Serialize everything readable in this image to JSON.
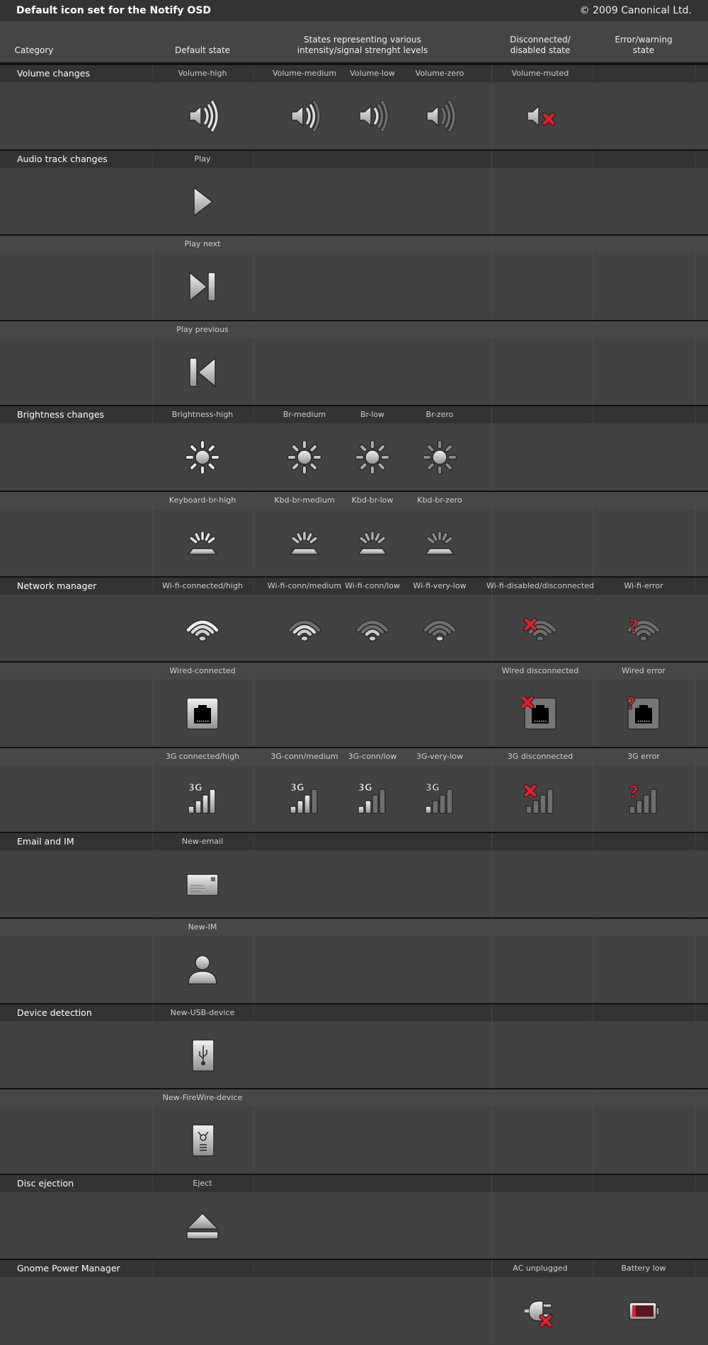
{
  "header": {
    "title": "Default icon set for the Notify OSD",
    "copyright": "© 2009 Canonical Ltd."
  },
  "columns": {
    "category": "Category",
    "default": "Default state",
    "intensity": "States representing various\nintensity/signal strenght levels",
    "disconnected": "Disconnected/\ndisabled state",
    "error": "Error/warning\nstate"
  },
  "rows": [
    {
      "category": "Volume changes",
      "cells": [
        {
          "label": "Volume-high",
          "icon": "volume",
          "level": 3
        },
        {
          "label": "Volume-medium",
          "icon": "volume",
          "level": 2
        },
        {
          "label": "Volume-low",
          "icon": "volume",
          "level": 1
        },
        {
          "label": "Volume-zero",
          "icon": "volume",
          "level": 0
        },
        {
          "label": "Volume-muted",
          "icon": "volume",
          "level": -1,
          "overlay": "x"
        },
        null
      ]
    },
    {
      "category": "Audio track changes",
      "cells": [
        {
          "label": "Play",
          "icon": "play"
        },
        null,
        null,
        null,
        null,
        null
      ]
    },
    {
      "category": "",
      "cells": [
        {
          "label": "Play next",
          "icon": "next"
        },
        null,
        null,
        null,
        null,
        null
      ]
    },
    {
      "category": "",
      "cells": [
        {
          "label": "Play previous",
          "icon": "prev"
        },
        null,
        null,
        null,
        null,
        null
      ]
    },
    {
      "category": "Brightness changes",
      "cells": [
        {
          "label": "Brightness-high",
          "icon": "brightness",
          "level": 3
        },
        {
          "label": "Br-medium",
          "icon": "brightness",
          "level": 2
        },
        {
          "label": "Br-low",
          "icon": "brightness",
          "level": 1
        },
        {
          "label": "Br-zero",
          "icon": "brightness",
          "level": 0
        },
        null,
        null
      ]
    },
    {
      "category": "",
      "cells": [
        {
          "label": "Keyboard-br-high",
          "icon": "kbd",
          "level": 3
        },
        {
          "label": "Kbd-br-medium",
          "icon": "kbd",
          "level": 2
        },
        {
          "label": "Kbd-br-low",
          "icon": "kbd",
          "level": 1
        },
        {
          "label": "Kbd-br-zero",
          "icon": "kbd",
          "level": 0
        },
        null,
        null
      ]
    },
    {
      "category": "Network manager",
      "cells": [
        {
          "label": "Wi-fi-connected/high",
          "icon": "wifi",
          "level": 3
        },
        {
          "label": "Wi-fi-conn/medium",
          "icon": "wifi",
          "level": 2
        },
        {
          "label": "Wi-fi-conn/low",
          "icon": "wifi",
          "level": 1
        },
        {
          "label": "Wi-fi-very-low",
          "icon": "wifi",
          "level": 0
        },
        {
          "label": "Wi-fi-disabled/disconnected",
          "icon": "wifi",
          "level": -1,
          "overlay": "x"
        },
        {
          "label": "Wi-fi-error",
          "icon": "wifi",
          "level": -1,
          "overlay": "?"
        }
      ]
    },
    {
      "category": "",
      "cells": [
        {
          "label": "Wired-connected",
          "icon": "wired",
          "level": 1
        },
        null,
        null,
        null,
        {
          "label": "Wired disconnected",
          "icon": "wired",
          "level": 0,
          "overlay": "x"
        },
        {
          "label": "Wired error",
          "icon": "wired",
          "level": 0,
          "overlay": "?"
        }
      ]
    },
    {
      "category": "",
      "cells": [
        {
          "label": "3G connected/high",
          "icon": "3g",
          "level": 4
        },
        {
          "label": "3G-conn/medium",
          "icon": "3g",
          "level": 3
        },
        {
          "label": "3G-conn/low",
          "icon": "3g",
          "level": 2
        },
        {
          "label": "3G-very-low",
          "icon": "3g",
          "level": 1
        },
        {
          "label": "3G disconnected",
          "icon": "3g",
          "level": -1,
          "overlay": "x"
        },
        {
          "label": "3G error",
          "icon": "3g",
          "level": -1,
          "overlay": "?"
        }
      ]
    },
    {
      "category": "Email and IM",
      "cells": [
        {
          "label": "New-email",
          "icon": "email"
        },
        null,
        null,
        null,
        null,
        null
      ]
    },
    {
      "category": "",
      "cells": [
        {
          "label": "New-IM",
          "icon": "im"
        },
        null,
        null,
        null,
        null,
        null
      ]
    },
    {
      "category": "Device detection",
      "cells": [
        {
          "label": "New-USB-device",
          "icon": "usb"
        },
        null,
        null,
        null,
        null,
        null
      ]
    },
    {
      "category": "",
      "cells": [
        {
          "label": "New-FireWire-device",
          "icon": "firewire"
        },
        null,
        null,
        null,
        null,
        null
      ]
    },
    {
      "category": "Disc ejection",
      "cells": [
        {
          "label": "Eject",
          "icon": "eject"
        },
        null,
        null,
        null,
        null,
        null
      ]
    },
    {
      "category": "Gnome Power Manager",
      "cells": [
        null,
        null,
        null,
        null,
        {
          "label": "AC unplugged",
          "icon": "ac",
          "overlay": "x"
        },
        {
          "label": "Battery low",
          "icon": "battery"
        }
      ]
    }
  ],
  "colors": {
    "background": "#424242",
    "strip": "#333333",
    "error": "#e0202a"
  }
}
